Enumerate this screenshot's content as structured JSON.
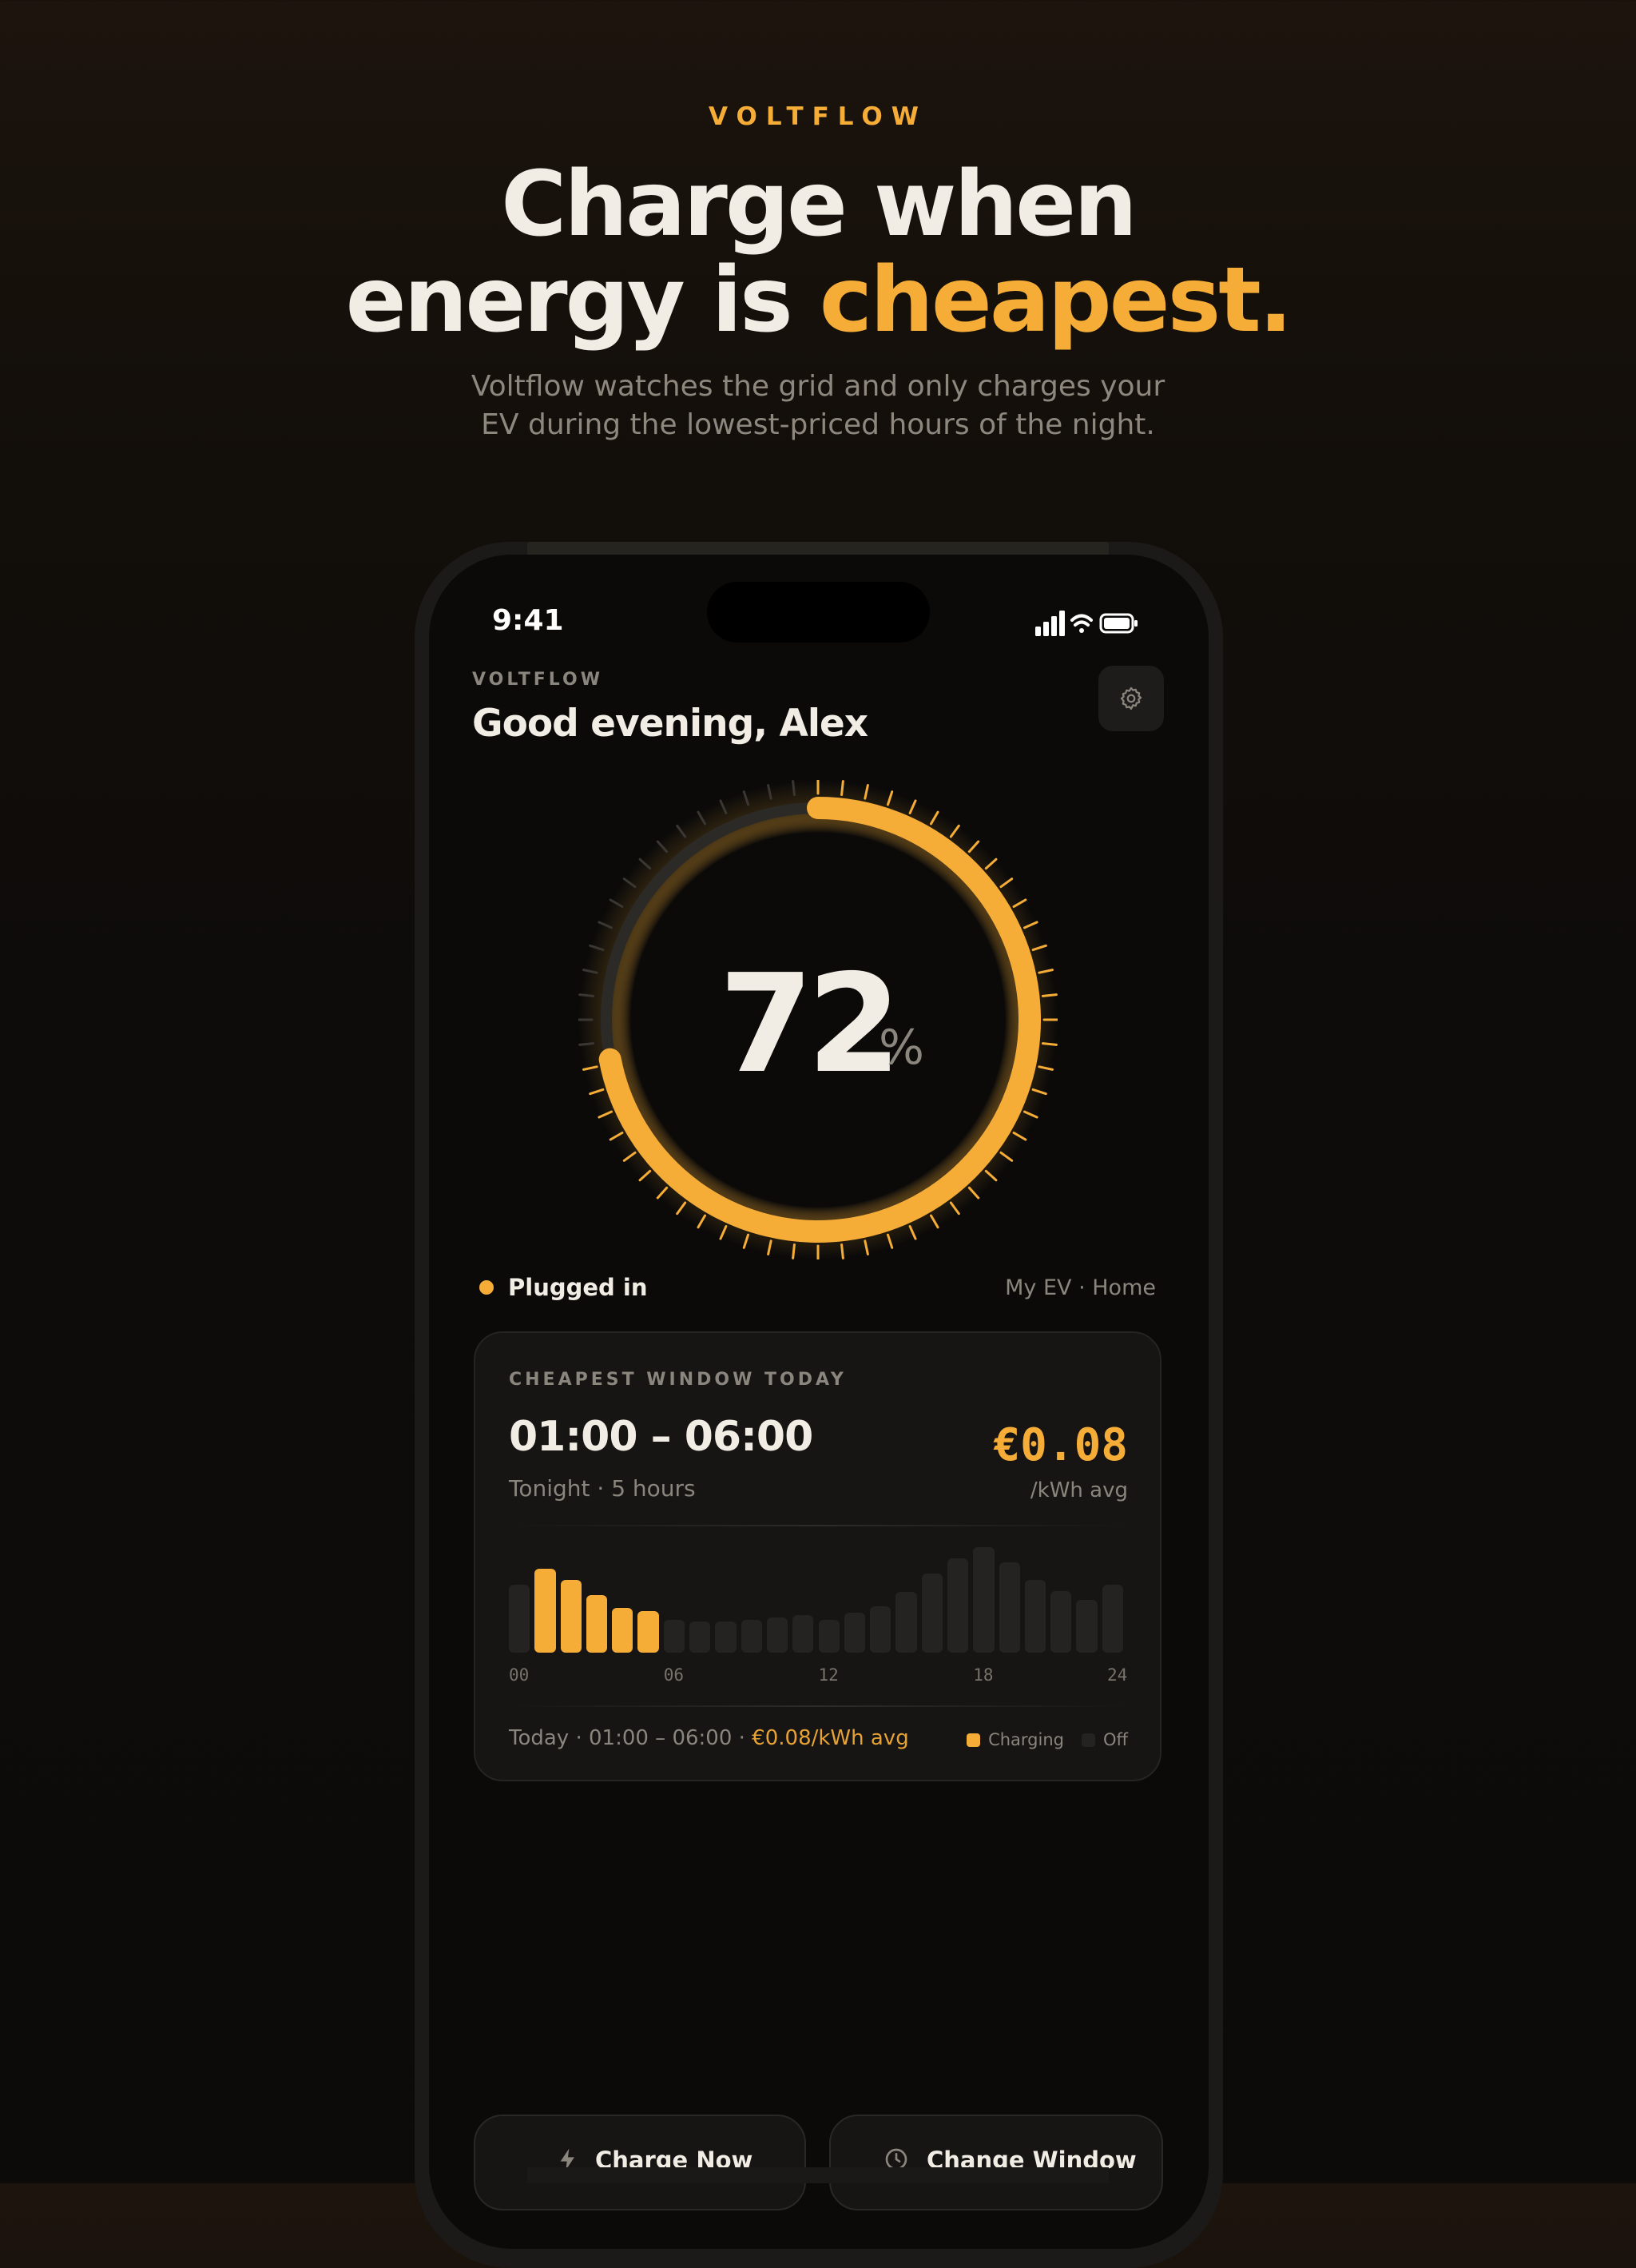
{
  "hero": {
    "eyebrow": "VOLTFLOW",
    "headline_line1": "Charge when",
    "headline_line2_prefix": "energy is",
    "headline_line2_accent": "cheapest.",
    "subtitle_line1": "Voltflow watches the grid and only charges your",
    "subtitle_line2": "EV during the lowest-priced hours of the night."
  },
  "status_bar": {
    "time": "9:41",
    "icons": [
      "signal-icon",
      "wifi-icon",
      "battery-icon"
    ]
  },
  "app_header": {
    "brand": "VOLTFLOW",
    "greeting": "Good evening, Alex",
    "settings_icon": "gear-icon"
  },
  "battery": {
    "level_percent": 72,
    "value": "72",
    "unit": "%"
  },
  "connection": {
    "status": "Plugged in",
    "vehicle": "My EV · Home"
  },
  "cheapest_window": {
    "title": "CHEAPEST WINDOW TODAY",
    "time_range": "01:00 – 06:00",
    "subtitle": "Tonight · 5 hours",
    "price": "€0.08",
    "price_unit": "/kWh avg",
    "footer_prefix": "Today · 01:00 – 06:00 · ",
    "footer_price": "€0.08/kWh avg",
    "legend_charging": "Charging",
    "legend_off": "Off",
    "axis_labels": [
      "00",
      "06",
      "12",
      "18",
      "24"
    ]
  },
  "chart_data": {
    "type": "bar",
    "categories": [
      "00",
      "01",
      "02",
      "03",
      "04",
      "05",
      "06",
      "07",
      "08",
      "09",
      "10",
      "11",
      "12",
      "13",
      "14",
      "15",
      "16",
      "17",
      "18",
      "19",
      "20",
      "21",
      "22",
      "23"
    ],
    "values": [
      0.62,
      0.76,
      0.66,
      0.52,
      0.41,
      0.38,
      0.3,
      0.28,
      0.28,
      0.3,
      0.32,
      0.34,
      0.3,
      0.36,
      0.42,
      0.55,
      0.72,
      0.86,
      0.96,
      0.82,
      0.66,
      0.56,
      0.48,
      0.62
    ],
    "charging_hours": [
      1,
      2,
      3,
      4,
      5
    ],
    "x_ticks": [
      "00",
      "06",
      "12",
      "18",
      "24"
    ],
    "colors": {
      "charging": "#f5ad37",
      "off": "#252321"
    },
    "title": "",
    "xlabel": "",
    "ylabel": ""
  },
  "actions": {
    "charge_now": "Charge Now",
    "change_window": "Change Window"
  },
  "theme": {
    "accent": "#f5ad37",
    "background": "#0b0a09",
    "text": "#f1ede4",
    "muted": "#8a857d"
  }
}
